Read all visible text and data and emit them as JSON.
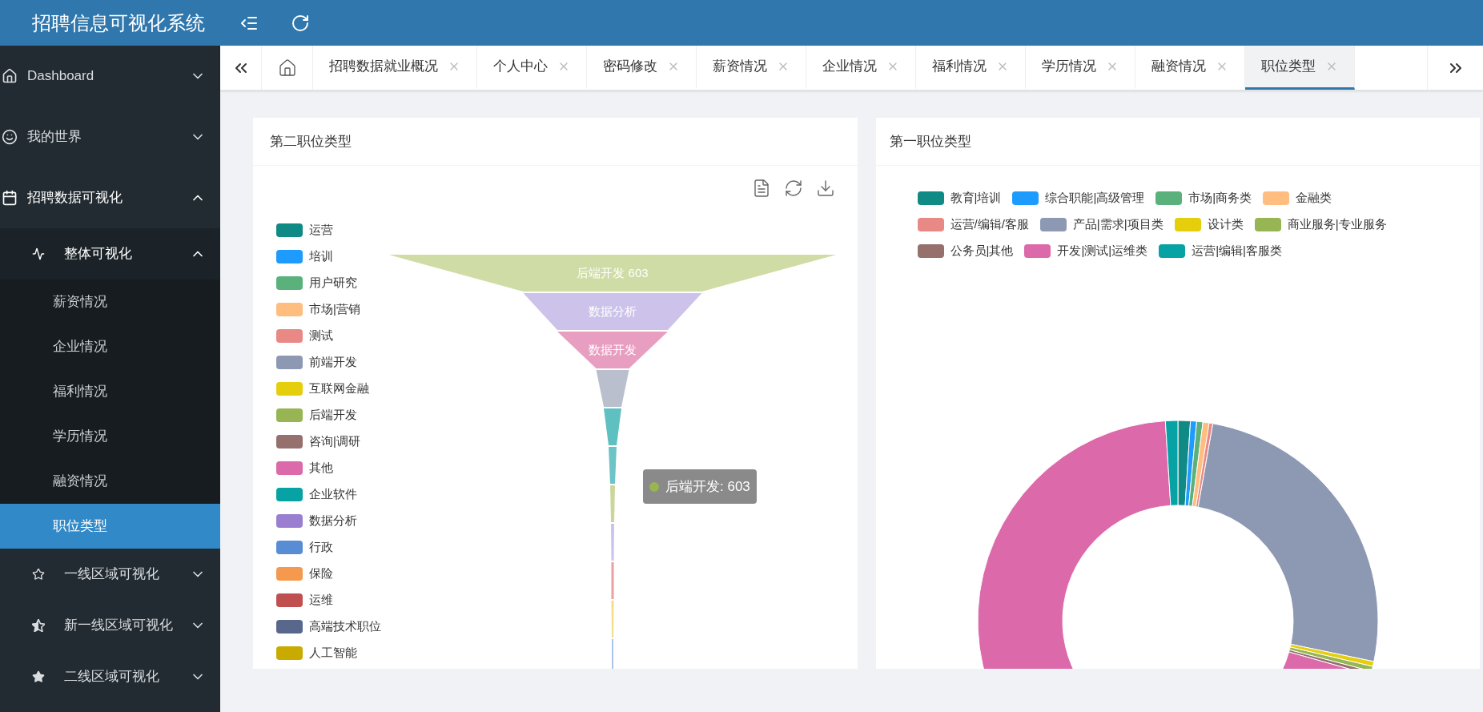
{
  "header": {
    "title": "招聘信息可视化系统"
  },
  "sidebar": {
    "items": [
      {
        "label": "Dashboard",
        "expanded": false
      },
      {
        "label": "我的世界",
        "expanded": false
      },
      {
        "label": "招聘数据可视化",
        "expanded": true,
        "children": [
          {
            "label": "整体可视化",
            "expanded": true,
            "children": [
              {
                "label": "薪资情况",
                "selected": false
              },
              {
                "label": "企业情况",
                "selected": false
              },
              {
                "label": "福利情况",
                "selected": false
              },
              {
                "label": "学历情况",
                "selected": false
              },
              {
                "label": "融资情况",
                "selected": false
              },
              {
                "label": "职位类型",
                "selected": true
              }
            ]
          },
          {
            "label": "一线区域可视化",
            "expanded": false
          },
          {
            "label": "新一线区域可视化",
            "expanded": false
          },
          {
            "label": "二线区域可视化",
            "expanded": false
          }
        ]
      }
    ]
  },
  "tabs": [
    {
      "label": "招聘数据就业概况",
      "selected": false
    },
    {
      "label": "个人中心",
      "selected": false
    },
    {
      "label": "密码修改",
      "selected": false
    },
    {
      "label": "薪资情况",
      "selected": false
    },
    {
      "label": "企业情况",
      "selected": false
    },
    {
      "label": "福利情况",
      "selected": false
    },
    {
      "label": "学历情况",
      "selected": false
    },
    {
      "label": "融资情况",
      "selected": false
    },
    {
      "label": "职位类型",
      "selected": true
    }
  ],
  "funnel_card": {
    "title": "第二职位类型",
    "legend": [
      {
        "label": "运营",
        "color": "#108a84"
      },
      {
        "label": "培训",
        "color": "#1e9bff"
      },
      {
        "label": "用户研究",
        "color": "#5ab17b"
      },
      {
        "label": "市场|营销",
        "color": "#ffbd80"
      },
      {
        "label": "测试",
        "color": "#e88985"
      },
      {
        "label": "前端开发",
        "color": "#8d98b3"
      },
      {
        "label": "互联网金融",
        "color": "#e5cf0d"
      },
      {
        "label": "后端开发",
        "color": "#97b552"
      },
      {
        "label": "咨询|调研",
        "color": "#95706d"
      },
      {
        "label": "其他",
        "color": "#dc69aa"
      },
      {
        "label": "企业软件",
        "color": "#07a2a4"
      },
      {
        "label": "数据分析",
        "color": "#9a7fd1"
      },
      {
        "label": "行政",
        "color": "#588dd5"
      },
      {
        "label": "保险",
        "color": "#f5994e"
      },
      {
        "label": "运维",
        "color": "#c05050"
      },
      {
        "label": "高端技术职位",
        "color": "#59678c"
      },
      {
        "label": "人工智能",
        "color": "#c9ab00"
      }
    ],
    "segments": [
      {
        "label": "后端开发 603",
        "color": "#cfdca5"
      },
      {
        "label": "数据分析",
        "color": "#cdc3ea"
      },
      {
        "label": "数据开发",
        "color": "#e89ec0"
      },
      {
        "color": "#b9bfcc"
      },
      {
        "color": "#5fc0c2"
      },
      {
        "color": "#6cc4c6"
      },
      {
        "color": "#c9d89a"
      },
      {
        "color": "#cdc3ea"
      },
      {
        "color": "#e8a0a0"
      },
      {
        "color": "#f2dd88"
      },
      {
        "color": "#a9c6ea"
      }
    ],
    "tooltip": {
      "label": "后端开发: 603",
      "color": "#97b552"
    }
  },
  "donut_card": {
    "title": "第一职位类型",
    "legend": [
      {
        "label": "教育|培训",
        "color": "#108a84"
      },
      {
        "label": "综合职能|高级管理",
        "color": "#1e9bff"
      },
      {
        "label": "市场|商务类",
        "color": "#5ab17b"
      },
      {
        "label": "金融类",
        "color": "#ffbd80"
      },
      {
        "label": "运营/编辑/客服",
        "color": "#e88985"
      },
      {
        "label": "产品|需求|项目类",
        "color": "#8d98b3"
      },
      {
        "label": "设计类",
        "color": "#e5cf0d"
      },
      {
        "label": "商业服务|专业服务",
        "color": "#97b552"
      },
      {
        "label": "公务员|其他",
        "color": "#95706d"
      },
      {
        "label": "开发|测试|运维类",
        "color": "#dc69aa"
      },
      {
        "label": "运营|编辑|客服类",
        "color": "#07a2a4"
      }
    ]
  }
}
